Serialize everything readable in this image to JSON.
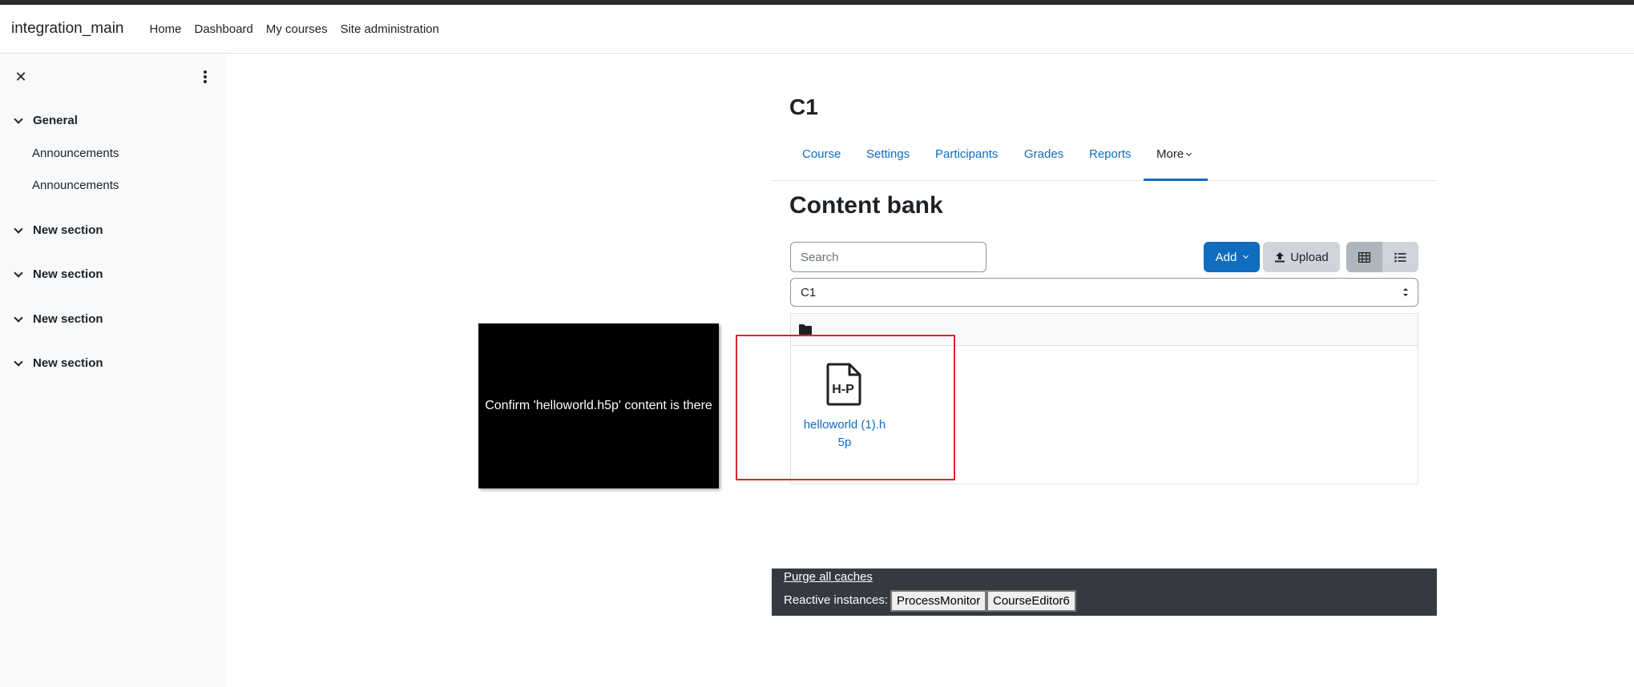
{
  "navbar": {
    "brand": "integration_main",
    "links": [
      "Home",
      "Dashboard",
      "My courses",
      "Site administration"
    ]
  },
  "drawer": {
    "close_icon": "close-icon",
    "menu_icon": "kebab-icon",
    "sections": [
      {
        "label": "General",
        "items": [
          "Announcements",
          "Announcements"
        ]
      },
      {
        "label": "New section",
        "items": []
      },
      {
        "label": "New section",
        "items": []
      },
      {
        "label": "New section",
        "items": []
      },
      {
        "label": "New section",
        "items": []
      }
    ]
  },
  "course": {
    "title": "C1",
    "tabs": [
      "Course",
      "Settings",
      "Participants",
      "Grades",
      "Reports",
      "More"
    ],
    "active_tab": "More"
  },
  "content_bank": {
    "heading": "Content bank",
    "search_placeholder": "Search",
    "add_label": "Add",
    "upload_label": "Upload",
    "view_grid_icon": "grid-icon",
    "view_list_icon": "list-icon",
    "context_select": "C1",
    "files": [
      {
        "name_line1": "helloworld (1).h",
        "name_line2": "5p",
        "icon": "h5p-file-icon"
      }
    ]
  },
  "overlay": {
    "text": "Confirm 'helloworld.h5p' content is there"
  },
  "footer": {
    "purge_label": "Purge all caches",
    "reactive_label": "Reactive instances:",
    "instances": [
      "ProcessMonitor",
      "CourseEditor6"
    ]
  },
  "colors": {
    "primary": "#0f6cbf",
    "highlight": "#d9272e",
    "footer_bg": "#343a40"
  }
}
